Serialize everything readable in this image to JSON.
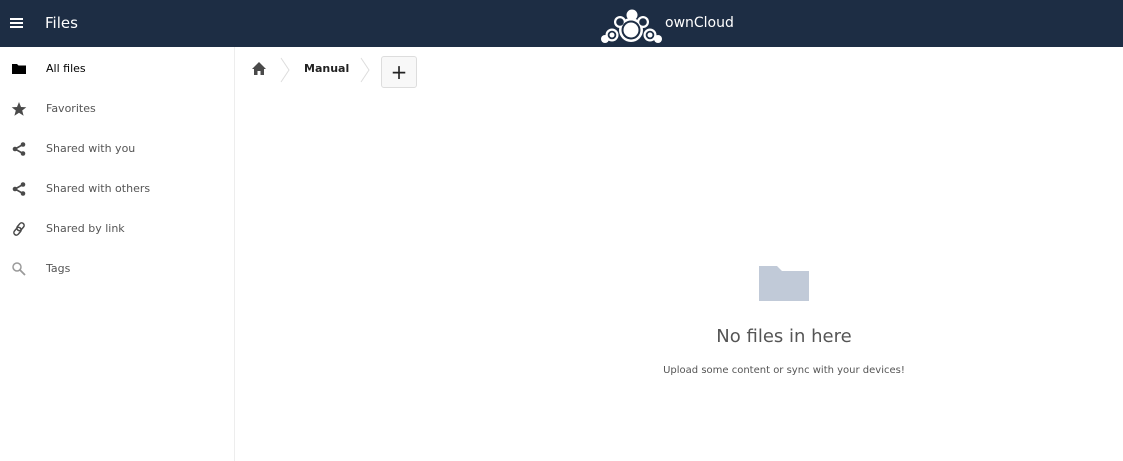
{
  "header": {
    "menu_icon": "hamburger-menu-icon",
    "app_title": "Files",
    "brand_logo": "owncloud-logo",
    "brand_name": "ownCloud"
  },
  "sidebar": {
    "items": [
      {
        "label": "All files",
        "icon": "folder-icon",
        "active": true
      },
      {
        "label": "Favorites",
        "icon": "star-icon"
      },
      {
        "label": "Shared with you",
        "icon": "share-icon"
      },
      {
        "label": "Shared with others",
        "icon": "share-icon"
      },
      {
        "label": "Shared by link",
        "icon": "link-icon"
      },
      {
        "label": "Tags",
        "icon": "search-icon"
      }
    ]
  },
  "breadcrumb": {
    "home_icon": "home-icon",
    "items": [
      "Manual"
    ],
    "new_label": "+"
  },
  "empty_state": {
    "icon": "folder-icon",
    "title": "No files in here",
    "description": "Upload some content or sync with your devices!"
  },
  "colors": {
    "header_bg": "#1d2d44",
    "empty_folder": "#c1cad8"
  }
}
